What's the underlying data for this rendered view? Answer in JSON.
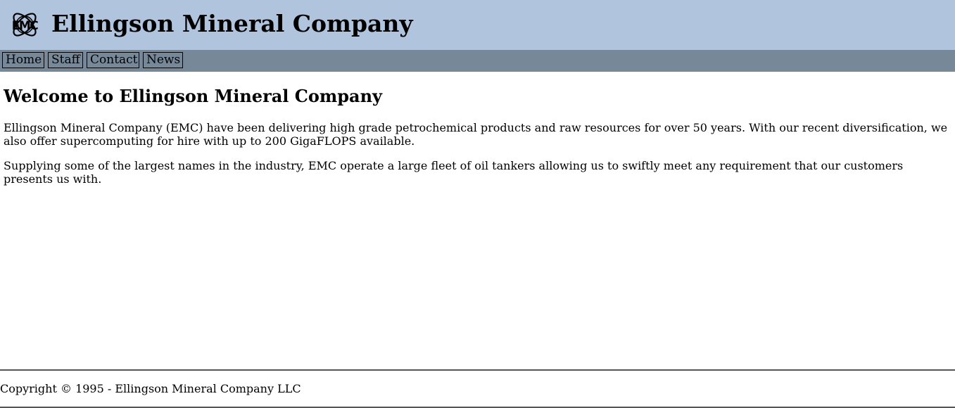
{
  "header": {
    "logo_icon": "emc-atom-logo-icon",
    "logo_text": "EMC",
    "title": "Ellingson Mineral Company",
    "background": "#b0c4de"
  },
  "nav": {
    "background": "#778899",
    "items": [
      {
        "label": "Home"
      },
      {
        "label": "Staff"
      },
      {
        "label": "Contact"
      },
      {
        "label": "News"
      }
    ]
  },
  "main": {
    "heading": "Welcome to Ellingson Mineral Company",
    "paragraphs": [
      "Ellingson Mineral Company (EMC) have been delivering high grade petrochemical products and raw resources for over 50 years. With our recent diversification, we also offer supercomputing for hire with up to 200 GigaFLOPS available.",
      "Supplying some of the largest names in the industry, EMC operate a large fleet of oil tankers allowing us to swiftly meet any requirement that our customers presents us with."
    ]
  },
  "footer": {
    "copyright": "Copyright © 1995 - Ellingson Mineral Company LLC"
  }
}
